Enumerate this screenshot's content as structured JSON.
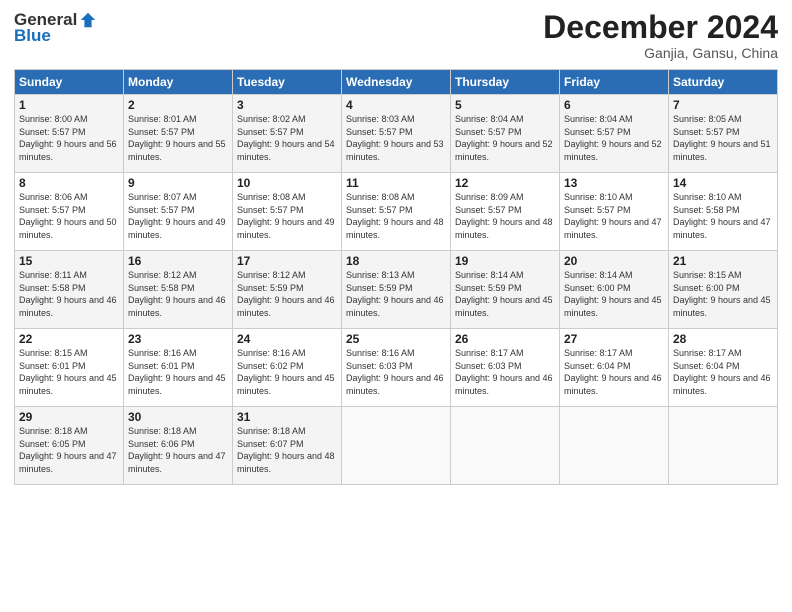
{
  "header": {
    "logo_general": "General",
    "logo_blue": "Blue",
    "month_title": "December 2024",
    "location": "Ganjia, Gansu, China"
  },
  "weekdays": [
    "Sunday",
    "Monday",
    "Tuesday",
    "Wednesday",
    "Thursday",
    "Friday",
    "Saturday"
  ],
  "weeks": [
    [
      {
        "day": 1,
        "sunrise": "8:00 AM",
        "sunset": "5:57 PM",
        "daylight": "9 hours and 56 minutes."
      },
      {
        "day": 2,
        "sunrise": "8:01 AM",
        "sunset": "5:57 PM",
        "daylight": "9 hours and 55 minutes."
      },
      {
        "day": 3,
        "sunrise": "8:02 AM",
        "sunset": "5:57 PM",
        "daylight": "9 hours and 54 minutes."
      },
      {
        "day": 4,
        "sunrise": "8:03 AM",
        "sunset": "5:57 PM",
        "daylight": "9 hours and 53 minutes."
      },
      {
        "day": 5,
        "sunrise": "8:04 AM",
        "sunset": "5:57 PM",
        "daylight": "9 hours and 52 minutes."
      },
      {
        "day": 6,
        "sunrise": "8:04 AM",
        "sunset": "5:57 PM",
        "daylight": "9 hours and 52 minutes."
      },
      {
        "day": 7,
        "sunrise": "8:05 AM",
        "sunset": "5:57 PM",
        "daylight": "9 hours and 51 minutes."
      }
    ],
    [
      {
        "day": 8,
        "sunrise": "8:06 AM",
        "sunset": "5:57 PM",
        "daylight": "9 hours and 50 minutes."
      },
      {
        "day": 9,
        "sunrise": "8:07 AM",
        "sunset": "5:57 PM",
        "daylight": "9 hours and 49 minutes."
      },
      {
        "day": 10,
        "sunrise": "8:08 AM",
        "sunset": "5:57 PM",
        "daylight": "9 hours and 49 minutes."
      },
      {
        "day": 11,
        "sunrise": "8:08 AM",
        "sunset": "5:57 PM",
        "daylight": "9 hours and 48 minutes."
      },
      {
        "day": 12,
        "sunrise": "8:09 AM",
        "sunset": "5:57 PM",
        "daylight": "9 hours and 48 minutes."
      },
      {
        "day": 13,
        "sunrise": "8:10 AM",
        "sunset": "5:57 PM",
        "daylight": "9 hours and 47 minutes."
      },
      {
        "day": 14,
        "sunrise": "8:10 AM",
        "sunset": "5:58 PM",
        "daylight": "9 hours and 47 minutes."
      }
    ],
    [
      {
        "day": 15,
        "sunrise": "8:11 AM",
        "sunset": "5:58 PM",
        "daylight": "9 hours and 46 minutes."
      },
      {
        "day": 16,
        "sunrise": "8:12 AM",
        "sunset": "5:58 PM",
        "daylight": "9 hours and 46 minutes."
      },
      {
        "day": 17,
        "sunrise": "8:12 AM",
        "sunset": "5:59 PM",
        "daylight": "9 hours and 46 minutes."
      },
      {
        "day": 18,
        "sunrise": "8:13 AM",
        "sunset": "5:59 PM",
        "daylight": "9 hours and 46 minutes."
      },
      {
        "day": 19,
        "sunrise": "8:14 AM",
        "sunset": "5:59 PM",
        "daylight": "9 hours and 45 minutes."
      },
      {
        "day": 20,
        "sunrise": "8:14 AM",
        "sunset": "6:00 PM",
        "daylight": "9 hours and 45 minutes."
      },
      {
        "day": 21,
        "sunrise": "8:15 AM",
        "sunset": "6:00 PM",
        "daylight": "9 hours and 45 minutes."
      }
    ],
    [
      {
        "day": 22,
        "sunrise": "8:15 AM",
        "sunset": "6:01 PM",
        "daylight": "9 hours and 45 minutes."
      },
      {
        "day": 23,
        "sunrise": "8:16 AM",
        "sunset": "6:01 PM",
        "daylight": "9 hours and 45 minutes."
      },
      {
        "day": 24,
        "sunrise": "8:16 AM",
        "sunset": "6:02 PM",
        "daylight": "9 hours and 45 minutes."
      },
      {
        "day": 25,
        "sunrise": "8:16 AM",
        "sunset": "6:03 PM",
        "daylight": "9 hours and 46 minutes."
      },
      {
        "day": 26,
        "sunrise": "8:17 AM",
        "sunset": "6:03 PM",
        "daylight": "9 hours and 46 minutes."
      },
      {
        "day": 27,
        "sunrise": "8:17 AM",
        "sunset": "6:04 PM",
        "daylight": "9 hours and 46 minutes."
      },
      {
        "day": 28,
        "sunrise": "8:17 AM",
        "sunset": "6:04 PM",
        "daylight": "9 hours and 46 minutes."
      }
    ],
    [
      {
        "day": 29,
        "sunrise": "8:18 AM",
        "sunset": "6:05 PM",
        "daylight": "9 hours and 47 minutes."
      },
      {
        "day": 30,
        "sunrise": "8:18 AM",
        "sunset": "6:06 PM",
        "daylight": "9 hours and 47 minutes."
      },
      {
        "day": 31,
        "sunrise": "8:18 AM",
        "sunset": "6:07 PM",
        "daylight": "9 hours and 48 minutes."
      },
      null,
      null,
      null,
      null
    ]
  ]
}
